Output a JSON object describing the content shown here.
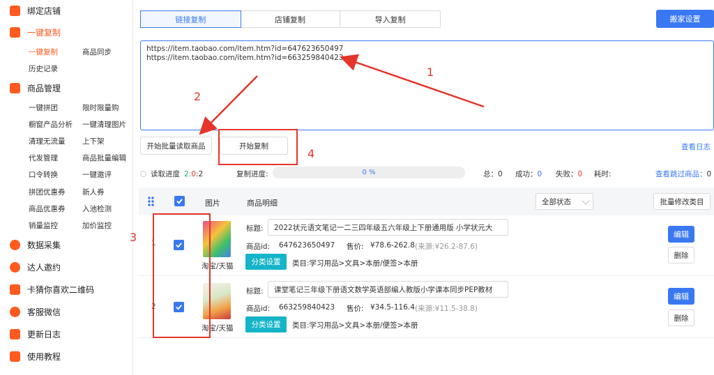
{
  "sidebar": {
    "main": [
      {
        "label": "绑定店铺",
        "icon": "store-icon"
      },
      {
        "label": "一键复制",
        "icon": "bag-icon"
      },
      {
        "label": "商品管理",
        "icon": "grid-icon"
      },
      {
        "label": "数据采集",
        "icon": "lightning-icon"
      },
      {
        "label": "达人邀约",
        "icon": "chat-icon"
      },
      {
        "label": "卡猜你喜欢二维码",
        "icon": "heart-icon"
      },
      {
        "label": "客服微信",
        "icon": "headset-icon"
      },
      {
        "label": "更新日志",
        "icon": "list-icon"
      },
      {
        "label": "使用教程",
        "icon": "book-icon"
      }
    ],
    "copy_sub": [
      "一键复制",
      "商品同步",
      "历史记录"
    ],
    "manage_sub": [
      [
        "一键拼团",
        "限时限量购"
      ],
      [
        "橱窗产品分析",
        "一键清理图片"
      ],
      [
        "清理无流量",
        "上下架"
      ],
      [
        "代发管理",
        "商品批量编辑"
      ],
      [
        "口令转换",
        "一键邀评"
      ],
      [
        "拼团优惠券",
        "新人券"
      ],
      [
        "商品优惠券",
        "入池检测"
      ],
      [
        "销量监控",
        "加价监控"
      ]
    ]
  },
  "tabs": [
    "链接复制",
    "店铺复制",
    "导入复制"
  ],
  "move_settings": "搬家设置",
  "url_lines": [
    "https://item.taobao.com/item.htm?id=647623650497",
    "https://item.taobao.com/item.htm?id=663259840423"
  ],
  "buttons": {
    "batch_read": "开始批量读取商品",
    "start_copy": "开始复制",
    "view_log": "查看日志",
    "batch_edit_category": "批量修改类目",
    "edit": "编辑",
    "delete": "删除",
    "category_settings": "分类设置"
  },
  "progress": {
    "read_label": "读取进度",
    "read_done": "2",
    "read_sep": ":",
    "read_fail": "0",
    "read_total": "2",
    "copy_label": "复制进度:",
    "copy_percent": "0 %",
    "total_label": "总：",
    "total_value": "0",
    "success_label": "成功：",
    "success_value": "0",
    "fail_label": "失败：",
    "fail_value": "0",
    "time_label": "耗时:",
    "skipped_label": "查看跳过商品：",
    "skipped_value": "0"
  },
  "table": {
    "col_image": "图片",
    "col_detail": "商品明细",
    "status_filter": "全部状态"
  },
  "labels": {
    "title": "标题:",
    "item_id": "商品id:",
    "price": "售价:",
    "source_prefix": "(来源:",
    "category_prefix": "类目:",
    "platform": "淘宝/天猫"
  },
  "products": [
    {
      "index": "1",
      "title": "2022状元语文笔记一二三四年级五六年级上下册通用版 小学状元大",
      "id": "647623650497",
      "price": "¥78.6-262.8",
      "source": "¥26.2-87.6)",
      "category": "学习用品>文具>本册/便签>本册"
    },
    {
      "index": "2",
      "title": "课堂笔记三年级下册语文数学英语部编人教版小学课本同步PEP教材",
      "id": "663259840423",
      "price": "¥34.5-116.4",
      "source": "¥11.5-38.8)",
      "category": "学习用品>文具>本册/便签>本册"
    }
  ],
  "annotations": [
    "1",
    "2",
    "3",
    "4"
  ],
  "colors": {
    "accent": "#3a78f2",
    "brand": "#ff5a1f",
    "annotation": "#e5342a",
    "cyan": "#15b4c8"
  }
}
